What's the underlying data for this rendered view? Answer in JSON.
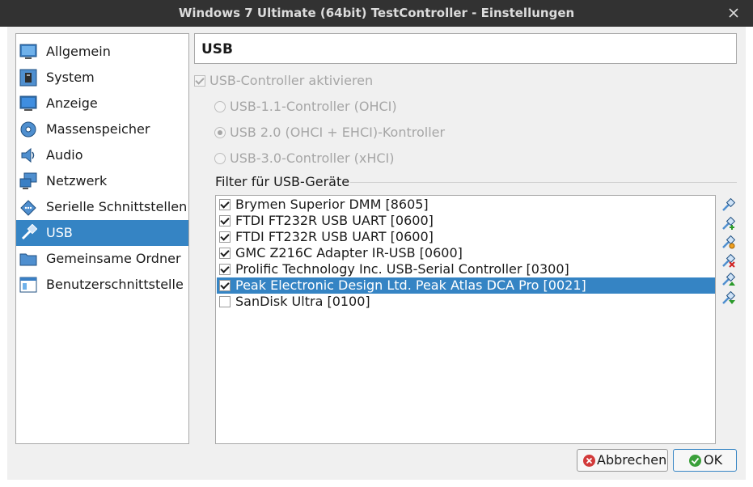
{
  "window": {
    "title": "Windows 7 Ultimate (64bit) TestController - Einstellungen"
  },
  "nav": {
    "items": [
      {
        "label": "Allgemein",
        "icon": "general-icon"
      },
      {
        "label": "System",
        "icon": "system-icon"
      },
      {
        "label": "Anzeige",
        "icon": "display-icon"
      },
      {
        "label": "Massenspeicher",
        "icon": "storage-icon"
      },
      {
        "label": "Audio",
        "icon": "audio-icon"
      },
      {
        "label": "Netzwerk",
        "icon": "network-icon"
      },
      {
        "label": "Serielle Schnittstellen",
        "icon": "serial-icon"
      },
      {
        "label": "USB",
        "icon": "usb-icon",
        "selected": true
      },
      {
        "label": "Gemeinsame Ordner",
        "icon": "folder-icon"
      },
      {
        "label": "Benutzerschnittstelle",
        "icon": "ui-icon"
      }
    ]
  },
  "page": {
    "title": "USB",
    "enable_controller": {
      "label": "USB-Controller aktivieren",
      "checked": true
    },
    "controller_options": [
      {
        "label": "USB-1.1-Controller (OHCI)",
        "selected": false
      },
      {
        "label": "USB 2.0 (OHCI + EHCI)-Kontroller",
        "selected": true
      },
      {
        "label": "USB-3.0-Controller (xHCI)",
        "selected": false
      }
    ],
    "filter_label": "Filter für USB-Geräte",
    "filters": [
      {
        "label": "Brymen Superior DMM [8605]",
        "checked": true
      },
      {
        "label": "FTDI FT232R USB UART [0600]",
        "checked": true
      },
      {
        "label": "FTDI FT232R USB UART [0600]",
        "checked": true
      },
      {
        "label": "GMC Z216C Adapter IR-USB [0600]",
        "checked": true
      },
      {
        "label": "Prolific Technology Inc. USB-Serial Controller [0300]",
        "checked": true
      },
      {
        "label": "Peak Electronic Design Ltd. Peak Atlas DCA Pro [0021]",
        "checked": true,
        "selected": true
      },
      {
        "label": "SanDisk Ultra [0100]",
        "checked": false
      }
    ],
    "filter_tools": [
      {
        "name": "add-empty-filter-button",
        "icon": "usb-add-icon"
      },
      {
        "name": "add-device-filter-button",
        "icon": "usb-add-green-icon"
      },
      {
        "name": "edit-filter-button",
        "icon": "usb-edit-icon"
      },
      {
        "name": "remove-filter-button",
        "icon": "usb-remove-icon"
      },
      {
        "name": "move-up-button",
        "icon": "usb-move-up-icon"
      },
      {
        "name": "move-down-button",
        "icon": "usb-move-down-icon"
      }
    ]
  },
  "footer": {
    "cancel_label": "Abbrechen",
    "ok_label": "OK"
  },
  "colors": {
    "selection": "#3584c4",
    "titlebar": "#323232",
    "dialog_bg": "#f0f0f0",
    "disabled_text": "#a6a6a6"
  }
}
